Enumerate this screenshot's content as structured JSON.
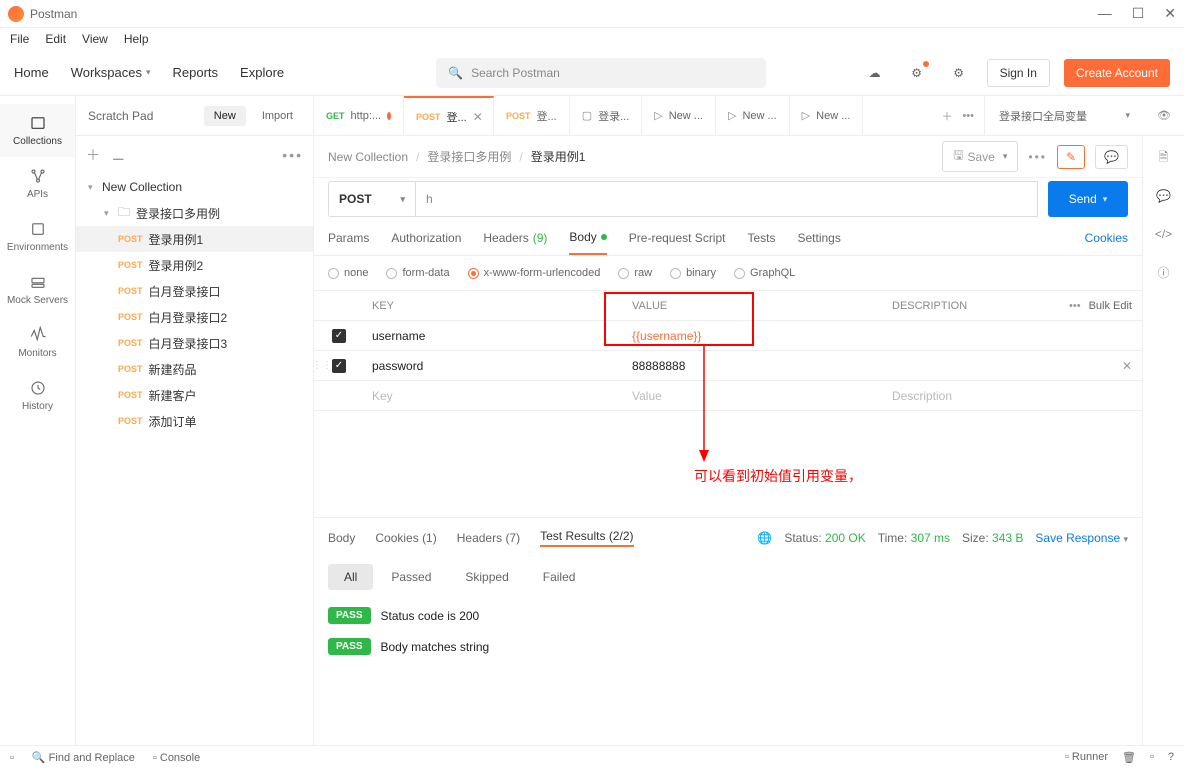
{
  "app": {
    "title": "Postman"
  },
  "menubar": [
    "File",
    "Edit",
    "View",
    "Help"
  ],
  "toolbar": {
    "home": "Home",
    "workspaces": "Workspaces",
    "reports": "Reports",
    "explore": "Explore",
    "search_placeholder": "Search Postman",
    "sign_in": "Sign In",
    "create_account": "Create Account"
  },
  "leftbar": [
    "Collections",
    "APIs",
    "Environments",
    "Mock Servers",
    "Monitors",
    "History"
  ],
  "sidebar": {
    "title": "Scratch Pad",
    "new": "New",
    "import": "Import",
    "collection": "New Collection",
    "folder": "登录接口多用例",
    "items": [
      {
        "method": "POST",
        "name": "登录用例1",
        "active": true
      },
      {
        "method": "POST",
        "name": "登录用例2"
      },
      {
        "method": "POST",
        "name": "白月登录接口"
      },
      {
        "method": "POST",
        "name": "白月登录接口2"
      },
      {
        "method": "POST",
        "name": "白月登录接口3"
      },
      {
        "method": "POST",
        "name": "新建药品"
      },
      {
        "method": "POST",
        "name": "新建客户"
      },
      {
        "method": "POST",
        "name": "添加订单"
      }
    ]
  },
  "tabs": [
    {
      "method": "GET",
      "label": "http:...",
      "dirty": true
    },
    {
      "method": "POST",
      "label": "登...",
      "active": true,
      "closable": true
    },
    {
      "method": "POST",
      "label": "登..."
    },
    {
      "icon": "env",
      "label": "登录..."
    },
    {
      "icon": "play",
      "label": "New ..."
    },
    {
      "icon": "play",
      "label": "New ..."
    },
    {
      "icon": "play",
      "label": "New ..."
    }
  ],
  "env_name": "登录接口全局变量",
  "breadcrumb": {
    "collection": "New Collection",
    "folder": "登录接口多用例",
    "request": "登录用例1",
    "save": "Save"
  },
  "request": {
    "method": "POST",
    "url": "h",
    "send": "Send"
  },
  "request_tabs": {
    "params": "Params",
    "auth": "Authorization",
    "headers": "Headers",
    "headers_count": "(9)",
    "body": "Body",
    "prereq": "Pre-request Script",
    "tests": "Tests",
    "settings": "Settings",
    "cookies": "Cookies"
  },
  "body_types": [
    "none",
    "form-data",
    "x-www-form-urlencoded",
    "raw",
    "binary",
    "GraphQL"
  ],
  "table": {
    "headers": {
      "key": "KEY",
      "value": "VALUE",
      "desc": "DESCRIPTION",
      "bulk": "Bulk Edit"
    },
    "rows": [
      {
        "key": "username",
        "value": "{{username}}",
        "var": true,
        "checked": true
      },
      {
        "key": "password",
        "value": "88888888",
        "checked": true,
        "handle": true,
        "del": true
      }
    ],
    "placeholder": {
      "key": "Key",
      "value": "Value",
      "desc": "Description"
    }
  },
  "annotation": "可以看到初始值引用变量，",
  "response_tabs": {
    "body": "Body",
    "cookies": "Cookies",
    "cookies_count": "(1)",
    "headers": "Headers",
    "headers_count": "(7)",
    "tests": "Test Results",
    "tests_count": "(2/2)"
  },
  "response_status": {
    "label": "Status:",
    "code": "200 OK",
    "time_label": "Time:",
    "time": "307 ms",
    "size_label": "Size:",
    "size": "343 B",
    "save": "Save Response"
  },
  "filters": [
    "All",
    "Passed",
    "Skipped",
    "Failed"
  ],
  "tests": [
    {
      "badge": "PASS",
      "text": "Status code is 200"
    },
    {
      "badge": "PASS",
      "text": "Body matches string"
    }
  ],
  "statusbar": {
    "find": "Find and Replace",
    "console": "Console",
    "runner": "Runner"
  }
}
